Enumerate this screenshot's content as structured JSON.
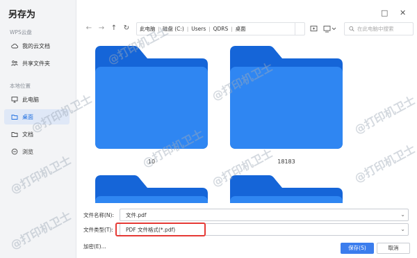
{
  "dialog": {
    "title": "另存为"
  },
  "sidebar": {
    "section_cloud": "WPS云盘",
    "cloud_items": [
      {
        "label": "我的云文档",
        "icon": "cloud-icon"
      },
      {
        "label": "共享文件夹",
        "icon": "share-icon"
      }
    ],
    "section_local": "本地位置",
    "local_items": [
      {
        "label": "此电脑",
        "icon": "monitor-icon"
      },
      {
        "label": "桌面",
        "icon": "folder-icon",
        "active": true
      },
      {
        "label": "文档",
        "icon": "folder-icon"
      },
      {
        "label": "浏览",
        "icon": "browse-icon"
      }
    ]
  },
  "window_controls": {
    "maximize": "□",
    "close": "✕"
  },
  "toolbar": {
    "back": "←",
    "forward": "→",
    "up": "↑",
    "refresh": "↻",
    "breadcrumb": [
      "此电脑",
      "磁盘 (C:)",
      "Users",
      "QDRS",
      "桌面"
    ],
    "search_placeholder": "在此电脑中搜索"
  },
  "folders": [
    {
      "label": "10"
    },
    {
      "label": "18183"
    },
    {
      "label": ""
    },
    {
      "label": ""
    }
  ],
  "bottom": {
    "filename_label": "文件名称(N):",
    "filename_value": "文件.pdf",
    "filetype_label": "文件类型(T):",
    "filetype_value": "PDF 文件格式(*.pdf)",
    "encrypt_label": "加密(E)...",
    "save_label": "保存(S)",
    "cancel_label": "取消"
  },
  "watermark": "@打印机卫士",
  "colors": {
    "accent": "#3b7ded",
    "folder": "#1f7ef0",
    "highlight": "#e53935"
  }
}
